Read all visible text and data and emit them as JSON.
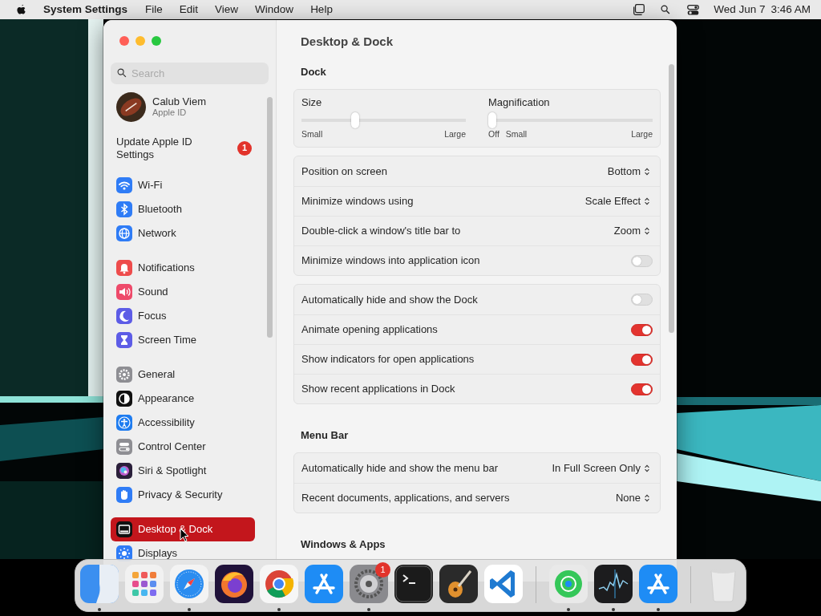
{
  "menu_bar": {
    "app_name": "System Settings",
    "menus": [
      "File",
      "Edit",
      "View",
      "Window",
      "Help"
    ],
    "date": "Wed Jun 7",
    "time": "3:46 AM"
  },
  "window": {
    "title": "Desktop & Dock"
  },
  "sidebar": {
    "search": {
      "placeholder": "Search"
    },
    "account": {
      "name": "Calub Viem",
      "subtitle": "Apple ID"
    },
    "notice": {
      "text": "Update Apple ID Settings",
      "badge": "1"
    },
    "groups": [
      [
        {
          "label": "Wi-Fi",
          "kind": "wifi",
          "selected": false
        },
        {
          "label": "Bluetooth",
          "kind": "bluetooth",
          "selected": false
        },
        {
          "label": "Network",
          "kind": "network",
          "selected": false
        }
      ],
      [
        {
          "label": "Notifications",
          "kind": "notifications",
          "selected": false
        },
        {
          "label": "Sound",
          "kind": "sound",
          "selected": false
        },
        {
          "label": "Focus",
          "kind": "focus",
          "selected": false
        },
        {
          "label": "Screen Time",
          "kind": "screentime",
          "selected": false
        }
      ],
      [
        {
          "label": "General",
          "kind": "general",
          "selected": false
        },
        {
          "label": "Appearance",
          "kind": "appearance",
          "selected": false
        },
        {
          "label": "Accessibility",
          "kind": "accessibility",
          "selected": false
        },
        {
          "label": "Control Center",
          "kind": "control",
          "selected": false
        },
        {
          "label": "Siri & Spotlight",
          "kind": "siri",
          "selected": false
        },
        {
          "label": "Privacy & Security",
          "kind": "privacy",
          "selected": false
        }
      ],
      [
        {
          "label": "Desktop & Dock",
          "kind": "desktop",
          "selected": true
        },
        {
          "label": "Displays",
          "kind": "displays",
          "selected": false
        }
      ]
    ]
  },
  "sections": [
    {
      "heading": "Dock",
      "cards": [
        {
          "kind": "sliders",
          "sliders": [
            {
              "label": "Size",
              "level": 0.32,
              "ticks": [
                "Small",
                "Large"
              ]
            },
            {
              "label": "Magnification",
              "level": 0,
              "ticks": [
                "Off",
                "Small",
                "Large"
              ]
            }
          ]
        },
        {
          "kind": "rows",
          "rows": [
            {
              "kind": "select",
              "label": "Position on screen",
              "value": "Bottom"
            },
            {
              "kind": "select",
              "label": "Minimize windows using",
              "value": "Scale Effect"
            },
            {
              "kind": "select",
              "label": "Double-click a window's title bar to",
              "value": "Zoom"
            },
            {
              "kind": "toggle",
              "label": "Minimize windows into application icon",
              "on": false
            }
          ]
        },
        {
          "kind": "rows",
          "rows": [
            {
              "kind": "toggle",
              "label": "Automatically hide and show the Dock",
              "on": false
            },
            {
              "kind": "toggle",
              "label": "Animate opening applications",
              "on": true
            },
            {
              "kind": "toggle",
              "label": "Show indicators for open applications",
              "on": true
            },
            {
              "kind": "toggle",
              "label": "Show recent applications in Dock",
              "on": true
            }
          ]
        }
      ]
    },
    {
      "heading": "Menu Bar",
      "cards": [
        {
          "kind": "rows",
          "rows": [
            {
              "kind": "select",
              "label": "Automatically hide and show the menu bar",
              "value": "In Full Screen Only"
            },
            {
              "kind": "select",
              "label": "Recent documents, applications, and servers",
              "value": "None"
            }
          ]
        }
      ]
    },
    {
      "heading": "Windows & Apps"
    }
  ],
  "dock": {
    "items": [
      {
        "kind": "finder",
        "running": true
      },
      {
        "kind": "launchpad",
        "running": false
      },
      {
        "kind": "safari",
        "running": true
      },
      {
        "kind": "firefox",
        "running": false
      },
      {
        "kind": "chrome",
        "running": true
      },
      {
        "kind": "appstore",
        "running": false
      },
      {
        "kind": "settings",
        "running": true,
        "badge": "1"
      },
      {
        "kind": "terminal",
        "running": false
      },
      {
        "kind": "garageband",
        "running": false
      },
      {
        "kind": "vscode",
        "running": false
      },
      {
        "kind": "divider"
      },
      {
        "kind": "findmy",
        "running": true
      },
      {
        "kind": "stocks",
        "running": true
      },
      {
        "kind": "appstore",
        "running": true
      },
      {
        "kind": "divider"
      },
      {
        "kind": "trash",
        "running": false
      }
    ]
  }
}
